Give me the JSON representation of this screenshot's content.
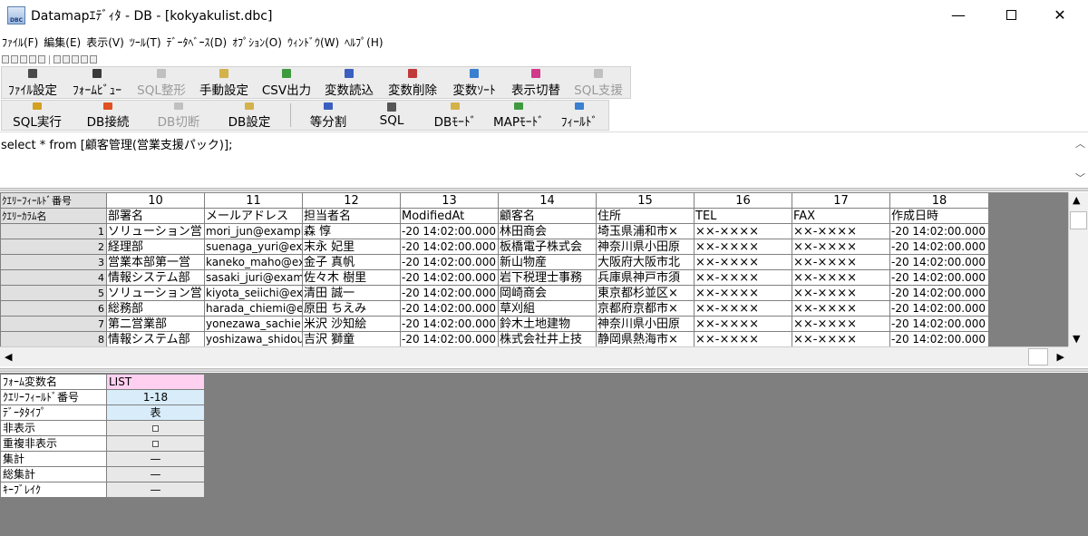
{
  "window": {
    "title": "Datamapｴﾃﾞｨﾀ - DB - [kokyakulist.dbc]",
    "app_icon_text": "DBC",
    "minimize": "—",
    "close": "✕"
  },
  "menu": [
    "ﾌｧｲﾙ(F)",
    "編集(E)",
    "表示(V)",
    "ﾂｰﾙ(T)",
    "ﾃﾞｰﾀﾍﾞｰｽ(D)",
    "ｵﾌﾟｼｮﾝ(O)",
    "ｳｨﾝﾄﾞｳ(W)",
    "ﾍﾙﾌﾟ(H)"
  ],
  "toolbar1": [
    {
      "label": "ﾌｧｲﾙ設定",
      "enabled": true,
      "color": "#4a4a4a"
    },
    {
      "label": "ﾌｫｰﾑﾋﾞｭｰ",
      "enabled": true,
      "color": "#3a3a3a"
    },
    {
      "label": "SQL整形",
      "enabled": false,
      "color": "#b0b0b0"
    },
    {
      "label": "手動設定",
      "enabled": true,
      "color": "#d4b24a"
    },
    {
      "label": "CSV出力",
      "enabled": true,
      "color": "#3f9a3f"
    },
    {
      "label": "変数読込",
      "enabled": true,
      "color": "#3a5fc0"
    },
    {
      "label": "変数削除",
      "enabled": true,
      "color": "#c03a3a"
    },
    {
      "label": "変数ｿｰﾄ",
      "enabled": true,
      "color": "#3a7fd0"
    },
    {
      "label": "表示切替",
      "enabled": true,
      "color": "#d03a8a"
    },
    {
      "label": "SQL支援",
      "enabled": false,
      "color": "#b0b0b0"
    }
  ],
  "toolbar2_left": [
    {
      "label": "SQL実行",
      "enabled": true,
      "color": "#d4a020"
    },
    {
      "label": "DB接続",
      "enabled": true,
      "color": "#e05020"
    },
    {
      "label": "DB切断",
      "enabled": false,
      "color": "#b0b0b0"
    },
    {
      "label": "DB設定",
      "enabled": true,
      "color": "#d4b24a"
    }
  ],
  "toolbar2_right": [
    {
      "label": "等分割",
      "enabled": true,
      "color": "#3a5fc0"
    },
    {
      "label": "SQL",
      "enabled": true,
      "color": "#555555"
    },
    {
      "label": "DBﾓｰﾄﾞ",
      "enabled": true,
      "color": "#d4b24a"
    },
    {
      "label": "MAPﾓｰﾄﾞ",
      "enabled": true,
      "color": "#3f9a3f"
    },
    {
      "label": "ﾌｨｰﾙﾄﾞ",
      "enabled": true,
      "color": "#3a7fd0"
    }
  ],
  "sql": {
    "text": "select * from [顧客管理(営業支援パック)];"
  },
  "grid": {
    "field_no_label": "ｸｴﾘｰﾌｨｰﾙﾄﾞ番号",
    "column_name_label": "ｸｴﾘｰｶﾗﾑ名",
    "field_numbers": [
      "10",
      "11",
      "12",
      "13",
      "14",
      "15",
      "16",
      "17",
      "18"
    ],
    "column_names": [
      "部署名",
      "メールアドレス",
      "担当者名",
      "ModifiedAt",
      "顧客名",
      "住所",
      "TEL",
      "FAX",
      "作成日時"
    ],
    "rows": [
      [
        "1",
        "ソリューション営",
        "mori_jun@example",
        "森 惇",
        "-20 14:02:00.000",
        "林田商会",
        "埼玉県浦和市×",
        "××-××××",
        "××-××××",
        "-20 14:02:00.000"
      ],
      [
        "2",
        "経理部",
        "suenaga_yuri@exa",
        "末永 妃里",
        "-20 14:02:00.000",
        "板橋電子株式会",
        "神奈川県小田原",
        "××-××××",
        "××-××××",
        "-20 14:02:00.000"
      ],
      [
        "3",
        "営業本部第一営",
        "kaneko_maho@ex",
        "金子 真帆",
        "-20 14:02:00.000",
        "新山物産",
        "大阪府大阪市北",
        "××-××××",
        "××-××××",
        "-20 14:02:00.000"
      ],
      [
        "4",
        "情報システム部",
        "sasaki_juri@exam",
        "佐々木 樹里",
        "-20 14:02:00.000",
        "岩下税理士事務",
        "兵庫県神戸市須",
        "××-××××",
        "××-××××",
        "-20 14:02:00.000"
      ],
      [
        "5",
        "ソリューション営",
        "kiyota_seiichi@ex",
        "清田 誠一",
        "-20 14:02:00.000",
        "岡崎商会",
        "東京都杉並区×",
        "××-××××",
        "××-××××",
        "-20 14:02:00.000"
      ],
      [
        "6",
        "総務部",
        "harada_chiemi@e",
        "原田 ちえみ",
        "-20 14:02:00.000",
        "草刈組",
        "京都府京都市×",
        "××-××××",
        "××-××××",
        "-20 14:02:00.000"
      ],
      [
        "7",
        "第二営業部",
        "yonezawa_sachie",
        "米沢 沙知絵",
        "-20 14:02:00.000",
        "鈴木土地建物",
        "神奈川県小田原",
        "××-××××",
        "××-××××",
        "-20 14:02:00.000"
      ],
      [
        "8",
        "情報システム部",
        "yoshizawa_shidou",
        "吉沢 獅童",
        "-20 14:02:00.000",
        "株式会社井上技",
        "静岡県熱海市×",
        "××-××××",
        "××-××××",
        "-20 14:02:00.000"
      ]
    ]
  },
  "props": {
    "form_var_label": "ﾌｫｰﾑ変数名",
    "form_var_value": "LIST",
    "field_no_label": "ｸｴﾘｰﾌｨｰﾙﾄﾞ番号",
    "field_no_value": "1-18",
    "data_type_label": "ﾃﾞｰﾀﾀｲﾌﾟ",
    "data_type_value": "表",
    "hidden_label": "非表示",
    "dup_hidden_label": "重複非表示",
    "aggregate_label": "集計",
    "aggregate_value": "—",
    "total_label": "総集計",
    "total_value": "—",
    "keybreak_label": "ｷｰﾌﾞﾚｲｸ",
    "keybreak_value": "—"
  }
}
